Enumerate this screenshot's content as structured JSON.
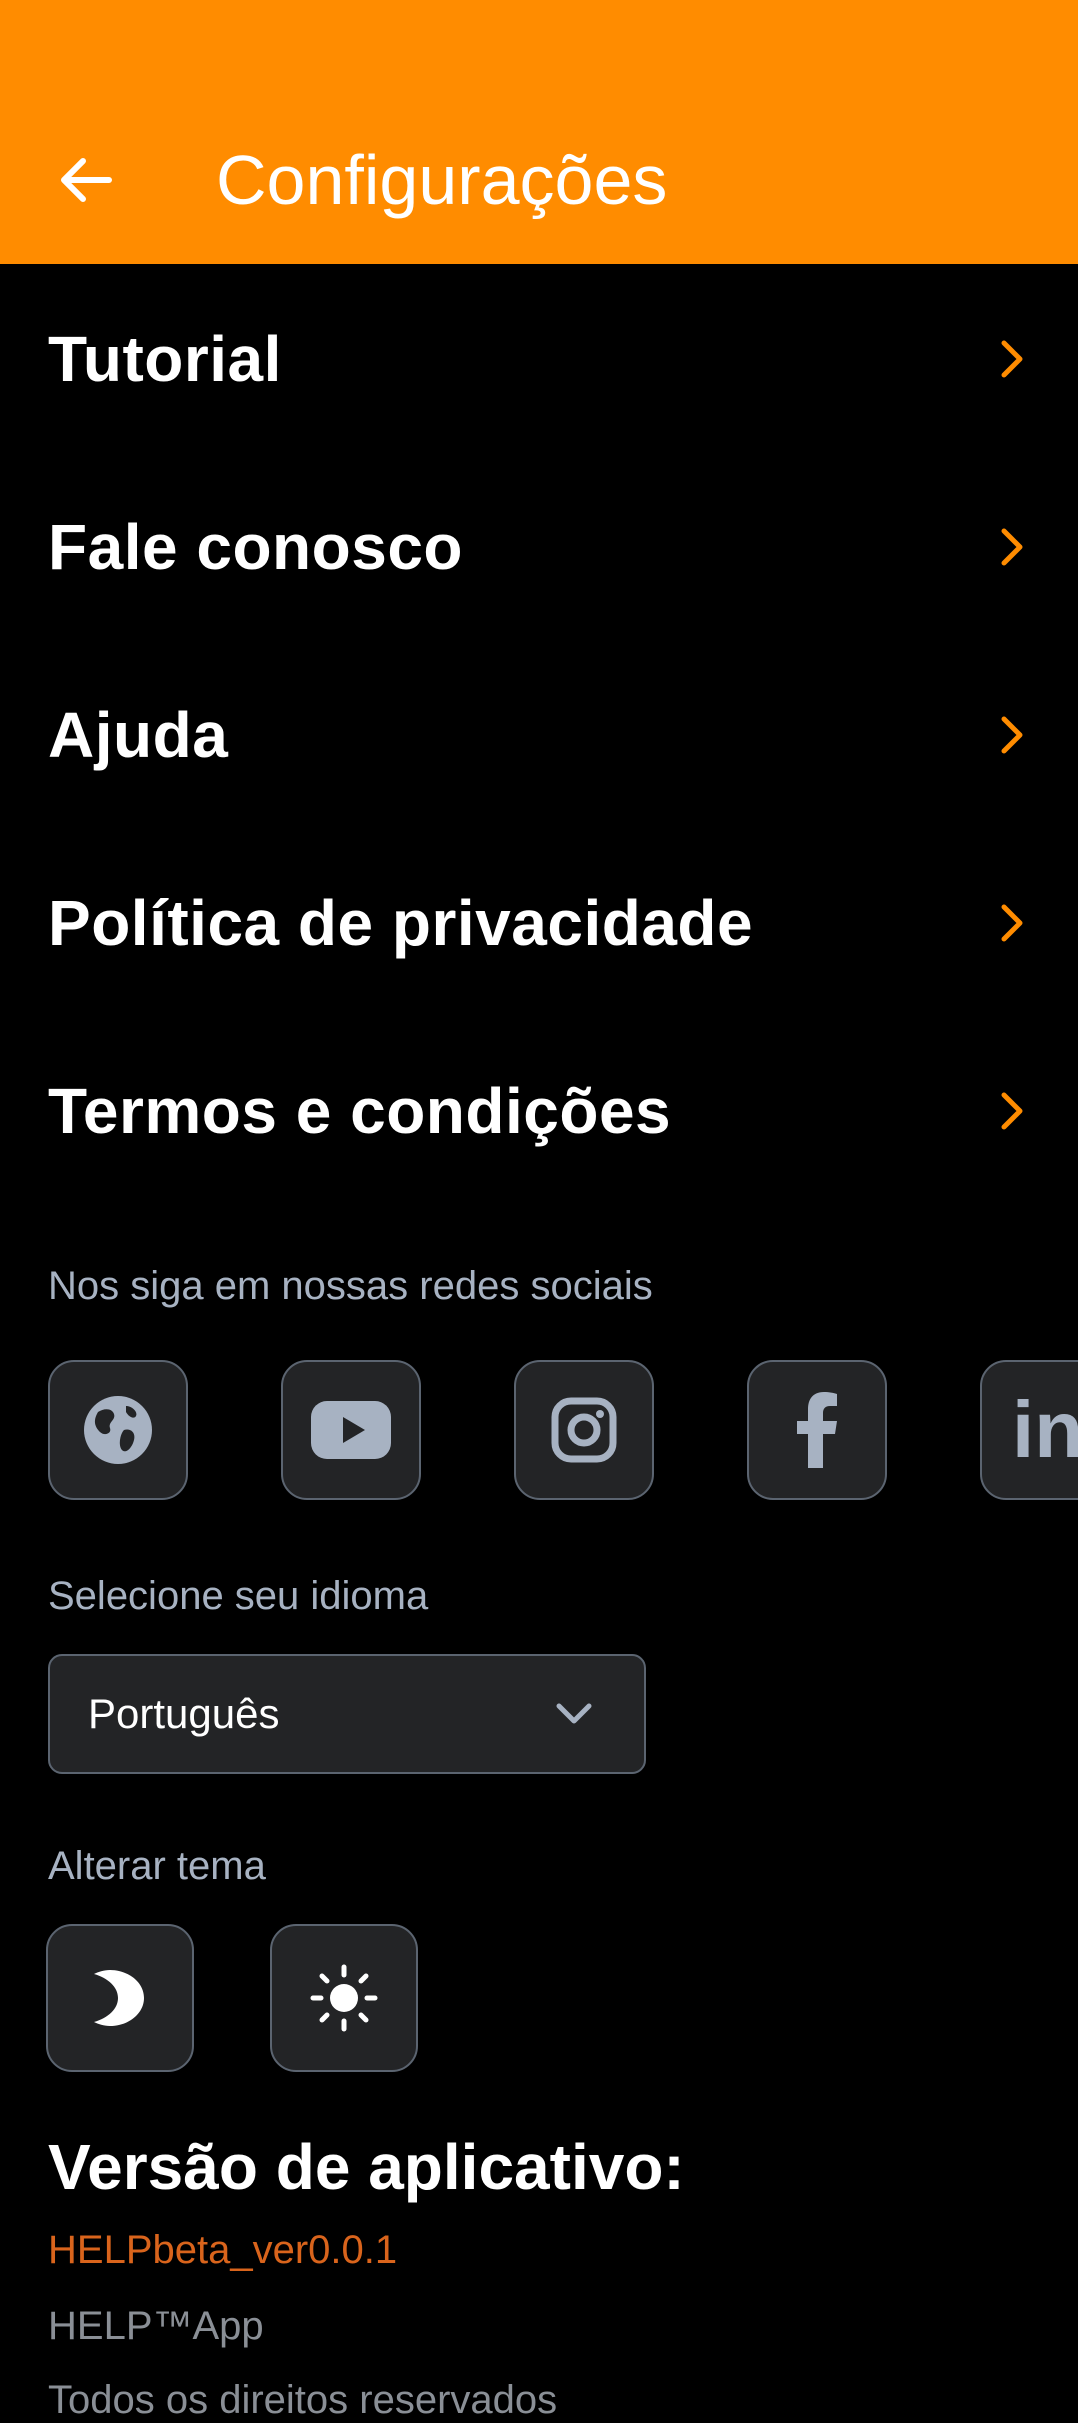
{
  "header": {
    "title": "Configurações",
    "back_icon": "arrow-left-icon",
    "background_color": "#FF8C00"
  },
  "menu": {
    "items": [
      {
        "label": "Tutorial",
        "icon": "chevron-right-icon"
      },
      {
        "label": "Fale conosco",
        "icon": "chevron-right-icon"
      },
      {
        "label": "Ajuda",
        "icon": "chevron-right-icon"
      },
      {
        "label": "Política de privacidade",
        "icon": "chevron-right-icon"
      },
      {
        "label": "Termos e condições",
        "icon": "chevron-right-icon"
      }
    ],
    "chevron_color": "#FF8C00"
  },
  "social": {
    "label": "Nos siga em nossas redes sociais",
    "links": [
      {
        "icon": "globe-icon"
      },
      {
        "icon": "youtube-icon"
      },
      {
        "icon": "instagram-icon"
      },
      {
        "icon": "facebook-icon"
      },
      {
        "icon": "linkedin-icon",
        "text": "in"
      }
    ]
  },
  "language": {
    "label": "Selecione seu idioma",
    "selected": "Português",
    "icon": "chevron-down-icon"
  },
  "theme": {
    "label": "Alterar tema",
    "options": [
      {
        "icon": "moon-icon"
      },
      {
        "icon": "sun-icon"
      }
    ]
  },
  "version": {
    "title": "Versão de aplicativo:",
    "value": "HELPbeta_ver0.0.1",
    "value_color": "#d9641c",
    "app_name": "HELP™App",
    "footer": "Todos os direitos reservados"
  }
}
